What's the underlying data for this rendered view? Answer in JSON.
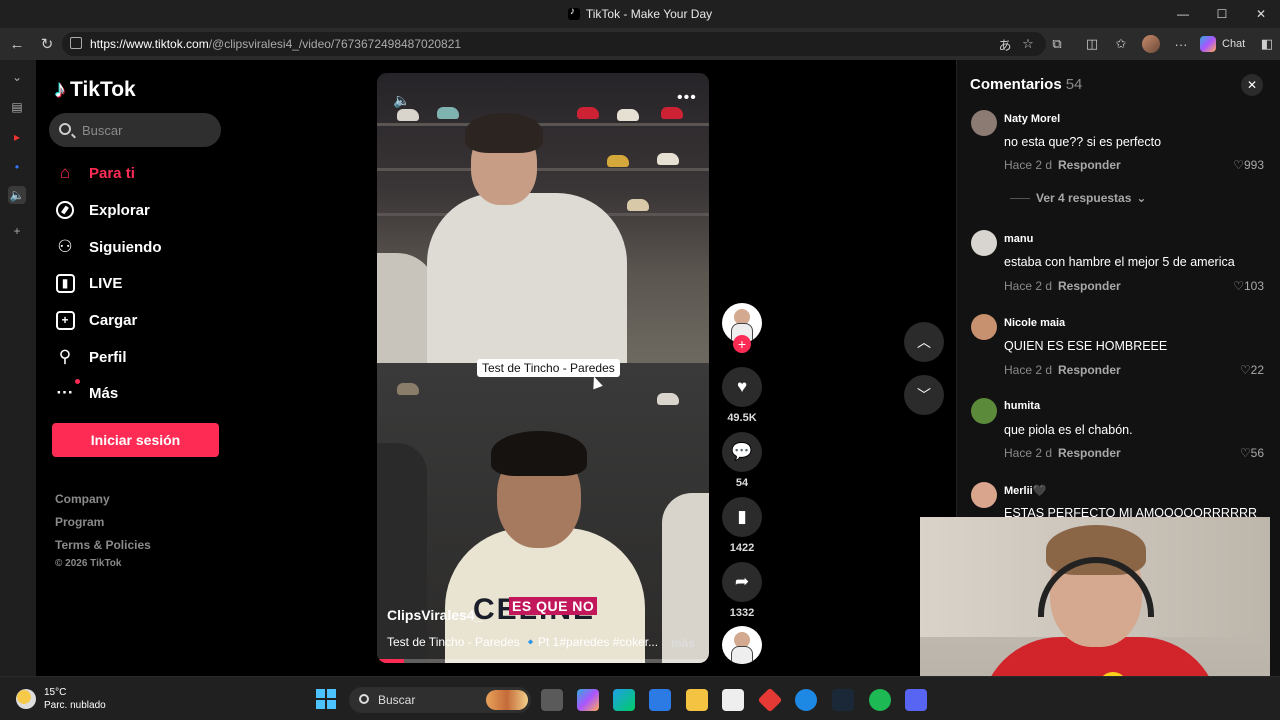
{
  "window": {
    "title": "TikTok - Make Your Day",
    "minimize": "—",
    "maximize": "☐",
    "close": "✕"
  },
  "browser": {
    "url_host": "https://www.tiktok.com",
    "url_path": "/@clipsviralesi4_/video/7673672498487020821",
    "chat_label": "Chat"
  },
  "sidebar": {
    "logo_text": "TikTok",
    "search_placeholder": "Buscar",
    "items": [
      {
        "label": "Para ti",
        "icon": "home-icon",
        "active": true
      },
      {
        "label": "Explorar",
        "icon": "compass-icon"
      },
      {
        "label": "Siguiendo",
        "icon": "following-icon"
      },
      {
        "label": "LIVE",
        "icon": "live-icon"
      },
      {
        "label": "Cargar",
        "icon": "upload-icon"
      },
      {
        "label": "Perfil",
        "icon": "profile-icon"
      },
      {
        "label": "Más",
        "icon": "more-icon"
      }
    ],
    "login_button": "Iniciar sesión",
    "footer_links": [
      "Company",
      "Program",
      "Terms & Policies"
    ],
    "copyright": "© 2026 TikTok"
  },
  "video": {
    "tag_label": "Test de Tincho - Paredes",
    "subtitle": "ES QUE NO",
    "shirt_text": "CELINE",
    "username": "ClipsVirales4_",
    "description": "Test de Tincho - Paredes 🔹Pt 1#paredes #coker...",
    "more_label": "más",
    "progress": 0.08
  },
  "actions": {
    "likes": "49.5K",
    "comments": "54",
    "saves": "1422",
    "shares": "1332"
  },
  "comments_panel": {
    "title": "Comentarios",
    "count": "54",
    "comments": [
      {
        "user": "Naty Morel",
        "text": "no esta que?? si es perfecto",
        "time": "Hace 2 d",
        "reply": "Responder",
        "likes": "993",
        "avatar_color": "#8b7b72"
      },
      {
        "user": "manu",
        "text": "estaba con hambre el mejor 5 de america",
        "time": "Hace 2 d",
        "reply": "Responder",
        "likes": "103",
        "avatar_color": "#d8d4cf"
      },
      {
        "user": "Nicole maia",
        "text": "QUIEN ES ESE HOMBREEE",
        "time": "Hace 2 d",
        "reply": "Responder",
        "likes": "22",
        "avatar_color": "#c7906e"
      },
      {
        "user": "humita",
        "text": "que piola es el chabón.",
        "time": "Hace 2 d",
        "reply": "Responder",
        "likes": "56",
        "avatar_color": "#5b8a3a"
      },
      {
        "user": "Merlii🖤",
        "text": "ESTAS PERFECTO MI AMOOOOORRRRRR",
        "avatar_color": "#d9a58c"
      }
    ],
    "view_replies": "Ver 4 respuestas"
  },
  "taskbar": {
    "temperature": "15°C",
    "weather": "Parc. nublado",
    "search_label": "Buscar"
  }
}
